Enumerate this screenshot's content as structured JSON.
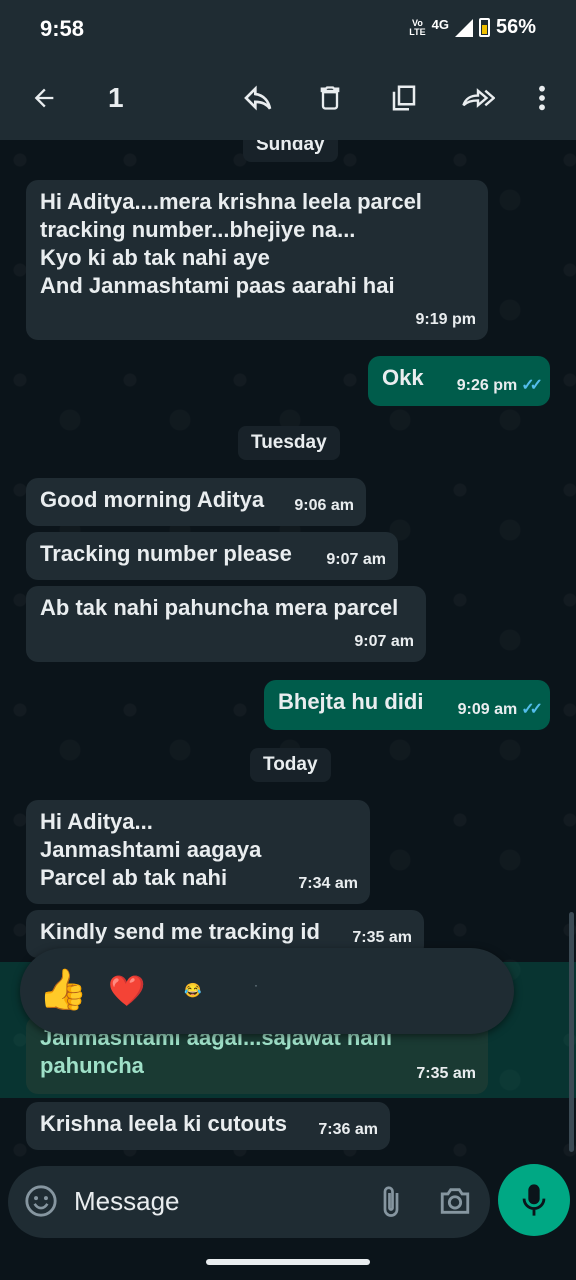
{
  "status": {
    "time": "9:58",
    "network_volte": "Vo LTE",
    "network_type": "4G",
    "battery": "56%"
  },
  "toolbar": {
    "selected_count": "1",
    "icons": [
      "back-arrow-icon",
      "reply-icon",
      "delete-icon",
      "copy-icon",
      "forward-icon",
      "more-icon"
    ]
  },
  "chat": {
    "day_sunday": "Sunday",
    "day_tuesday": "Tuesday",
    "day_today": "Today",
    "messages": [
      {
        "dir": "in",
        "text": "Hi Aditya....mera krishna leela parcel\ntracking number...bhejiye na...\nKyo ki ab tak nahi aye\nAnd Janmashtami paas aarahi hai",
        "time": "9:19 pm"
      },
      {
        "dir": "out",
        "text": "Okk",
        "time": "9:26 pm"
      },
      {
        "dir": "in",
        "text": "Good morning Aditya",
        "time": "9:06 am"
      },
      {
        "dir": "in",
        "text": "Tracking number please",
        "time": "9:07 am"
      },
      {
        "dir": "in",
        "text": "Ab tak nahi pahuncha mera parcel",
        "time": "9:07 am"
      },
      {
        "dir": "out",
        "text": "Bhejta hu didi",
        "time": "9:09 am"
      },
      {
        "dir": "in",
        "text": "Hi Aditya...\nJanmashtami aagaya\nParcel ab tak nahi",
        "time": "7:34 am"
      },
      {
        "dir": "in",
        "text": "Kindly send me tracking id",
        "time": "7:35 am"
      },
      {
        "dir": "in",
        "text": "Janmashtami aagai...sajawat nahi\npahuncha",
        "time": "7:35 am"
      },
      {
        "dir": "in",
        "text": "Krishna leela ki cutouts",
        "time": "7:36 am"
      }
    ]
  },
  "reactions": [
    "👍",
    "❤️",
    "😂",
    "·"
  ],
  "input": {
    "placeholder": "Message"
  },
  "colors": {
    "background": "#0b141a",
    "incoming_bubble": "#202c33",
    "outgoing_bubble": "#005c4b",
    "accent": "#00a884",
    "read_tick": "#53bdeb"
  }
}
